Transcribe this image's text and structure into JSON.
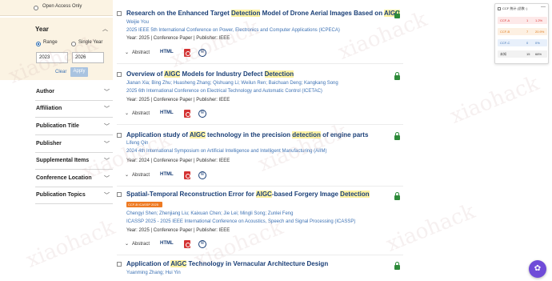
{
  "sidebar": {
    "open_access_label": "Open Access Only",
    "year": {
      "title": "Year",
      "range_label": "Range",
      "single_label": "Single Year",
      "from": "2023",
      "to": "2026",
      "clear_label": "Clear",
      "apply_label": "Apply"
    },
    "facets": [
      {
        "label": "Author"
      },
      {
        "label": "Affiliation"
      },
      {
        "label": "Publication Title"
      },
      {
        "label": "Publisher"
      },
      {
        "label": "Supplemental Items"
      },
      {
        "label": "Conference Location"
      },
      {
        "label": "Publication Topics"
      }
    ]
  },
  "common": {
    "abstract_label": "Abstract",
    "html_label": "HTML",
    "copyright_symbol": "©",
    "chevron_down": "⌄"
  },
  "results": [
    {
      "title_parts": [
        "Research on the Enhanced Target ",
        "Detection",
        " Model of Drone Aerial Images Based on ",
        "AIGC"
      ],
      "authors": "Weijie You",
      "venue": "2025 IEEE 5th International Conference on Power, Electronics and Computer Applications (ICPECA)",
      "meta": "Year: 2025  |  Conference Paper  |  Publisher: IEEE"
    },
    {
      "title_parts": [
        "Overview of ",
        "AIGC",
        " Models for Industry Defect  ",
        "Detection"
      ],
      "authors": "Jianan Xia; Bing Zhu; Huasheng Zhang; Qishuang Li; Weilun Ren; Baichuan Deng; Kangkang Song",
      "venue": "2025 6th International Conference on Electrical Technology and Automatic Control (ICETAC)",
      "meta": "Year: 2025  |  Conference Paper  |  Publisher: IEEE"
    },
    {
      "title_parts": [
        "Application study of ",
        "AIGC",
        " technology in the precision  ",
        "detection",
        " of engine parts"
      ],
      "authors": "Lifeng Qin",
      "venue": "2024 4th International Symposium on Artificial Intelligence and Intelligent Manufacturing (AIIM)",
      "meta": "Year: 2024  |  Conference Paper  |  Publisher: IEEE"
    },
    {
      "title_parts": [
        "Spatial-Temporal Reconstruction Error for ",
        "AIGC",
        "-based Forgery Image  ",
        "Detection"
      ],
      "badge": "CCF-B ICASSP 2025",
      "authors": "Chengyi Shen; Zhenjiang Liu; Kaixuan Chen; Jie Lei; Mingli Song; Zunlei Feng",
      "venue": "ICASSP 2025 - 2025 IEEE International Conference on Acoustics, Speech and Signal Processing (ICASSP)",
      "meta": "Year: 2025  |  Conference Paper  |  Publisher: IEEE"
    },
    {
      "title_parts": [
        "Application of ",
        "AIGC",
        " Technology in Vernacular Architecture Design"
      ],
      "authors": "Yuanming Zhang; Hui Yin"
    }
  ],
  "ccf_panel": {
    "header": "CCF 统计 (总数: )",
    "minimize": "—",
    "rows": [
      {
        "name": "CCF-A",
        "count": "1",
        "pct": "1.2%",
        "color": "#d33"
      },
      {
        "name": "CCF-B",
        "count": "7",
        "pct": "20.9%",
        "color": "#e07a1a"
      },
      {
        "name": "CCF-C",
        "count": "0",
        "pct": "0%",
        "color": "#3d72b4"
      },
      {
        "name": "未知",
        "count": "15",
        "pct": "68%",
        "color": "#333"
      }
    ]
  },
  "watermark_text": "xiaohack",
  "fab_icon": "✿"
}
